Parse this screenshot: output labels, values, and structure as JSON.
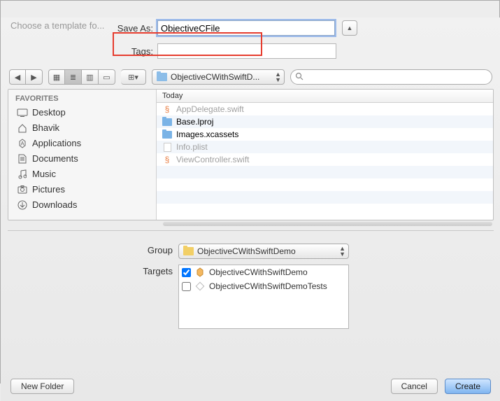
{
  "dim_heading": "Choose a template fo...",
  "save_as_label": "Save As:",
  "save_as_value": "ObjectiveCFile",
  "tags_label": "Tags:",
  "tags_value": "",
  "path_dropdown": "ObjectiveCWithSwiftD...",
  "search_placeholder": "",
  "sidebar": {
    "heading": "FAVORITES",
    "items": [
      "Desktop",
      "Bhavik",
      "Applications",
      "Documents",
      "Music",
      "Pictures",
      "Downloads"
    ]
  },
  "column_header": "Today",
  "files": {
    "f0": "AppDelegate.swift",
    "f1": "Base.lproj",
    "f2": "Images.xcassets",
    "f3": "Info.plist",
    "f4": "ViewController.swift"
  },
  "group_label": "Group",
  "group_value": "ObjectiveCWithSwiftDemo",
  "targets_label": "Targets",
  "targets": {
    "t0": "ObjectiveCWithSwiftDemo",
    "t1": "ObjectiveCWithSwiftDemoTests"
  },
  "buttons": {
    "new_folder": "New Folder",
    "cancel": "Cancel",
    "create": "Create"
  }
}
